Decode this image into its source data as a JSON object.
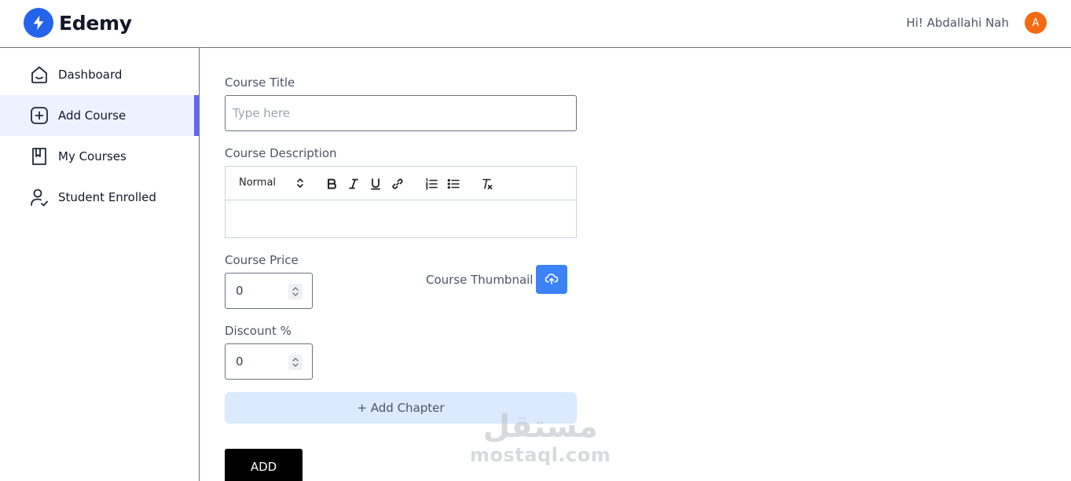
{
  "header": {
    "brand": "Edemy",
    "greeting": "Hi! Abdallahi Nah",
    "avatar_initial": "A",
    "brand_color": "#2563eb",
    "avatar_color": "#f46a12"
  },
  "sidebar": {
    "items": [
      {
        "label": "Dashboard",
        "icon": "home-icon",
        "active": false
      },
      {
        "label": "Add Course",
        "icon": "add-square-icon",
        "active": true
      },
      {
        "label": "My Courses",
        "icon": "book-icon",
        "active": false
      },
      {
        "label": "Student Enrolled",
        "icon": "user-check-icon",
        "active": false
      }
    ],
    "active_color": "#6366f1"
  },
  "form": {
    "title_label": "Course Title",
    "title_placeholder": "Type here",
    "title_value": "",
    "description_label": "Course Description",
    "editor": {
      "format_select": "Normal",
      "tools": [
        "bold-icon",
        "italic-icon",
        "underline-icon",
        "link-icon",
        "ordered-list-icon",
        "bullet-list-icon",
        "clear-format-icon"
      ],
      "content": ""
    },
    "price_label": "Course Price",
    "price_value": "0",
    "thumbnail_label": "Course Thumbnail",
    "thumbnail_icon": "upload-cloud-icon",
    "discount_label": "Discount %",
    "discount_value": "0",
    "add_chapter_label": "+ Add Chapter",
    "submit_label": "ADD"
  },
  "watermark": {
    "arabic": "مستقل",
    "latin": "mostaql.com"
  }
}
